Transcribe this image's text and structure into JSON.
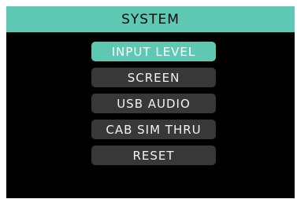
{
  "header": {
    "title": "SYSTEM"
  },
  "menu": {
    "items": [
      {
        "label": "INPUT LEVEL",
        "selected": true
      },
      {
        "label": "SCREEN",
        "selected": false
      },
      {
        "label": "USB AUDIO",
        "selected": false
      },
      {
        "label": "CAB SIM THRU",
        "selected": false
      },
      {
        "label": "RESET",
        "selected": false
      }
    ]
  },
  "colors": {
    "accent": "#5fc8b3",
    "background": "#000000",
    "item_background": "#383838",
    "item_text": "#f2f2f2",
    "header_text": "#0b0b0b"
  }
}
